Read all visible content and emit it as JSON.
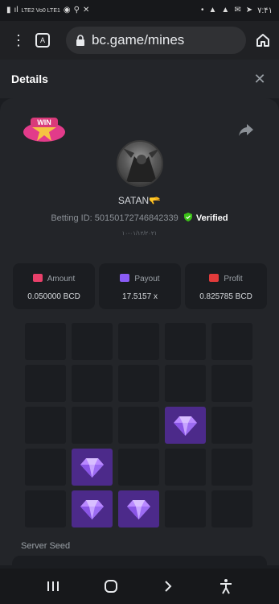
{
  "status_bar": {
    "left_text": "LTE2 Vo0 LTE1",
    "time": "۷:۴۱"
  },
  "browser": {
    "url": "bc.game/mines"
  },
  "details": {
    "title": "Details",
    "username": "SATAN🫳",
    "betting_label": "Betting ID: 5015017274684 2339",
    "betting_id": "Betting ID: 50150172746842339",
    "verified_label": "Verified",
    "date": "۱۰-۰۱/۱۲/۲۰۲۱"
  },
  "stats": {
    "amount": {
      "label": "Amount",
      "value": "0.050000 BCD",
      "icon_color": "#e9406a"
    },
    "payout": {
      "label": "Payout",
      "value": "17.5157 x",
      "icon_color": "#8a5cf6"
    },
    "profit": {
      "label": "Profit",
      "value": "0.825785 BCD",
      "icon_color": "#e23b3b"
    }
  },
  "grid": {
    "gems": [
      [
        2,
        3
      ],
      [
        3,
        1
      ],
      [
        4,
        1
      ],
      [
        4,
        2
      ]
    ]
  },
  "seed": {
    "label": "Server Seed"
  }
}
